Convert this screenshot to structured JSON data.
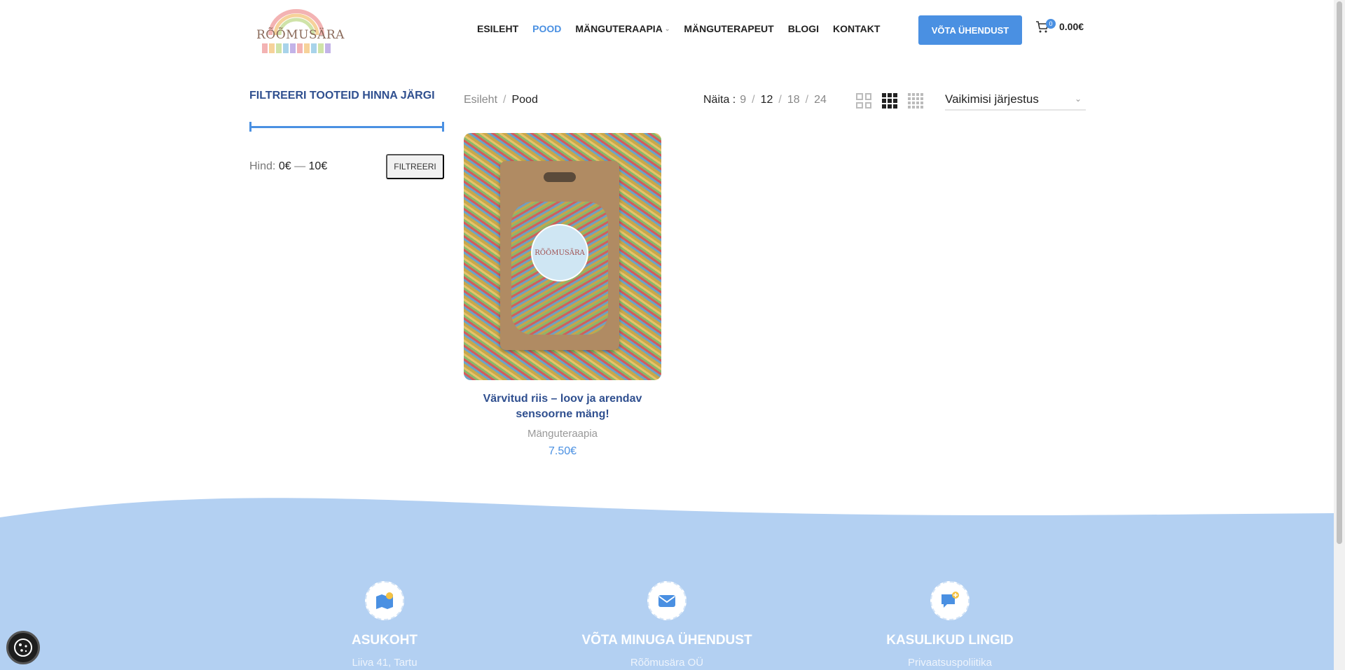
{
  "header": {
    "logo_text": "RÕÕMUSÄRA",
    "nav": [
      {
        "label": "ESILEHT",
        "active": false,
        "dropdown": false
      },
      {
        "label": "POOD",
        "active": true,
        "dropdown": false
      },
      {
        "label": "MÄNGUTERAAPIA",
        "active": false,
        "dropdown": true
      },
      {
        "label": "MÄNGUTERAPEUT",
        "active": false,
        "dropdown": false
      },
      {
        "label": "BLOGI",
        "active": false,
        "dropdown": false
      },
      {
        "label": "KONTAKT",
        "active": false,
        "dropdown": false
      }
    ],
    "contact_button": "VÕTA ÜHENDUST",
    "cart_count": "0",
    "cart_total": "0.00€"
  },
  "sidebar": {
    "title": "FILTREERI TOOTEID HINNA JÄRGI",
    "price_label": "Hind:",
    "price_min": "0€",
    "price_dash": "—",
    "price_max": "10€",
    "filter_button": "FILTREERI",
    "range_fraction": [
      0,
      1
    ]
  },
  "toolbar": {
    "breadcrumb_home": "Esileht",
    "breadcrumb_sep": "/",
    "breadcrumb_current": "Pood",
    "per_page_label": "Näita :",
    "per_page_options": [
      "9",
      "12",
      "18",
      "24"
    ],
    "per_page_selected": "12",
    "sort_label": "Vaikimisi järjestus"
  },
  "products": [
    {
      "title": "Värvitud riis – loov ja arendav sensoorne mäng!",
      "category": "Mänguteraapia",
      "price": "7.50€",
      "image_label": "RÕÕMUSÄRA"
    }
  ],
  "footer": {
    "columns": [
      {
        "icon": "map-pin-icon",
        "title": "ASUKOHT",
        "text": "Liiva 41, Tartu"
      },
      {
        "icon": "envelope-icon",
        "title": "VÕTA MINUGA ÜHENDUST",
        "text": "Rõõmusära OÜ"
      },
      {
        "icon": "chat-bubble-icon",
        "title": "KASULIKUD LINGID",
        "text": "Privaatsuspoliitika"
      }
    ]
  },
  "colors": {
    "accent": "#4a90e2",
    "title_blue": "#2f4f8f",
    "footer_bg": "#b3d0f2"
  }
}
